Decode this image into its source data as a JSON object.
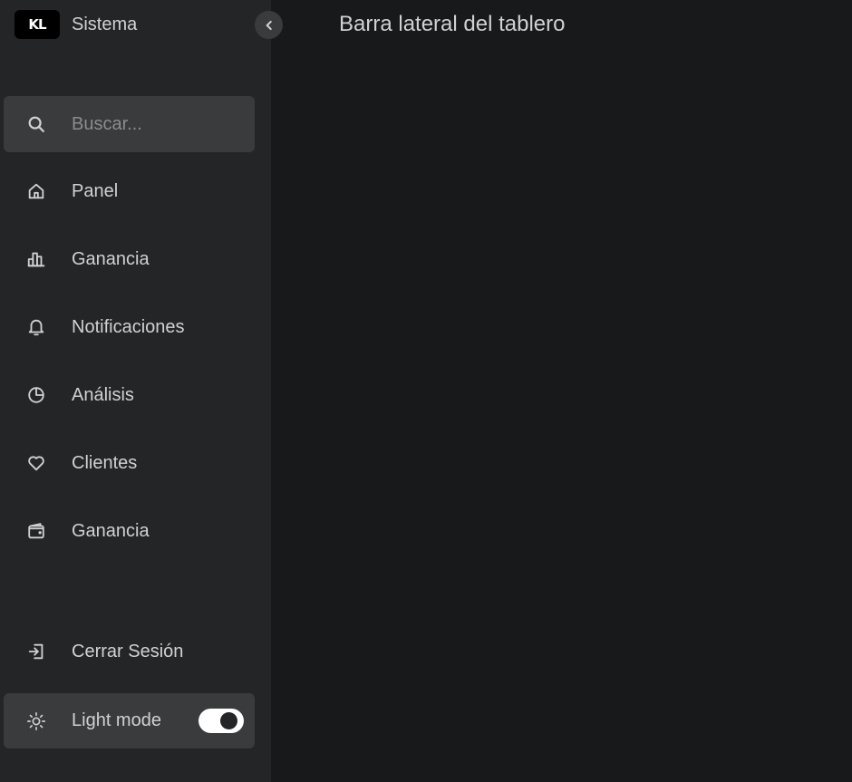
{
  "sidebar": {
    "logo_text": "KL",
    "brand_name": "Sistema",
    "collapse_icon": "chevron-left-icon",
    "search": {
      "placeholder": "Buscar...",
      "value": "",
      "icon": "search-icon"
    },
    "items": [
      {
        "label": "Panel",
        "icon": "home-icon"
      },
      {
        "label": "Ganancia",
        "icon": "bar-chart-icon"
      },
      {
        "label": "Notificaciones",
        "icon": "bell-icon"
      },
      {
        "label": "Análisis",
        "icon": "pie-chart-icon"
      },
      {
        "label": "Clientes",
        "icon": "heart-icon"
      },
      {
        "label": "Ganancia",
        "icon": "wallet-icon"
      }
    ],
    "logout": {
      "label": "Cerrar Sesión",
      "icon": "logout-icon"
    },
    "mode": {
      "label": "Light mode",
      "icon": "sun-icon",
      "toggle_on": true
    }
  },
  "main": {
    "title": "Barra lateral del tablero"
  },
  "colors": {
    "page_bg": "#18191a",
    "sidebar_bg": "#242526",
    "highlight_bg": "#3a3b3c",
    "text": "#cfd1d4",
    "placeholder": "#8a8c8f"
  }
}
